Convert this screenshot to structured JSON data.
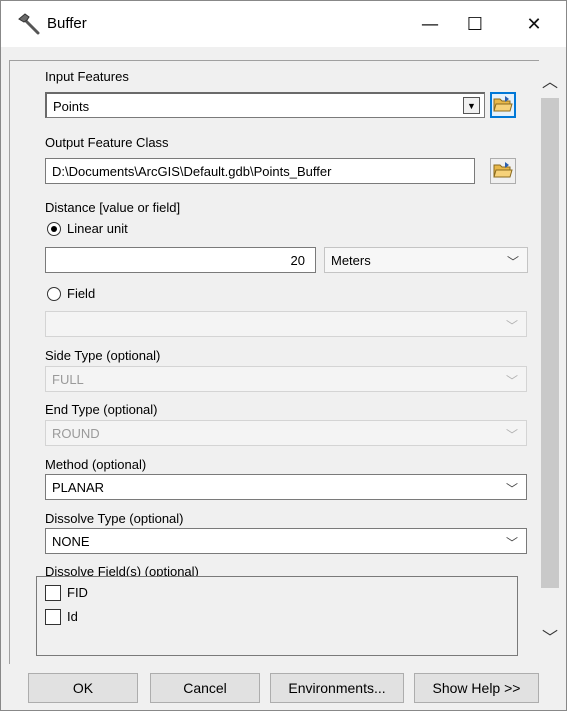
{
  "window": {
    "title": "Buffer",
    "icon": "hammer-icon",
    "controls": {
      "minimize": "—",
      "maximize": "☐",
      "close": "✕"
    }
  },
  "form": {
    "input_features": {
      "label": "Input Features",
      "value": "Points"
    },
    "output_feature_class": {
      "label": "Output Feature Class",
      "value": "D:\\Documents\\ArcGIS\\Default.gdb\\Points_Buffer"
    },
    "distance": {
      "label": "Distance [value or field]",
      "linear_unit_label": "Linear unit",
      "linear_unit_selected": true,
      "value": "20",
      "unit": "Meters",
      "field_label": "Field",
      "field_value": ""
    },
    "side_type": {
      "label": "Side Type (optional)",
      "value": "FULL"
    },
    "end_type": {
      "label": "End Type (optional)",
      "value": "ROUND"
    },
    "method": {
      "label": "Method (optional)",
      "value": "PLANAR"
    },
    "dissolve_type": {
      "label": "Dissolve Type (optional)",
      "value": "NONE"
    },
    "dissolve_fields": {
      "label": "Dissolve Field(s) (optional)",
      "items": [
        {
          "label": "FID",
          "checked": false
        },
        {
          "label": "Id",
          "checked": false
        }
      ]
    }
  },
  "buttons": {
    "ok": "OK",
    "cancel": "Cancel",
    "environments": "Environments...",
    "show_help": "Show Help >>"
  },
  "colors": {
    "accent": "#0078d7",
    "folder": "#e8b84a"
  }
}
